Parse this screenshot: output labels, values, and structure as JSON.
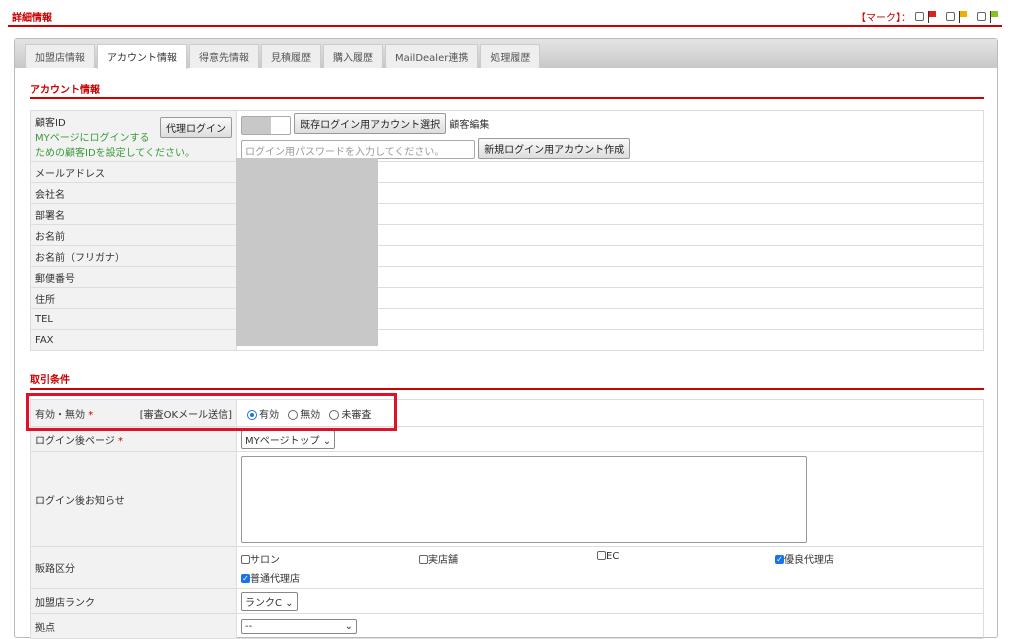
{
  "header": {
    "title": "詳細情報",
    "marks_label": "【マーク】：",
    "mark_colors": [
      "#e02020",
      "#f0b000",
      "#8ac020"
    ]
  },
  "tabs": [
    "加盟店情報",
    "アカウント情報",
    "得意先情報",
    "見積履歴",
    "購入履歴",
    "MailDealer連携",
    "処理履歴"
  ],
  "active_tab": 1,
  "account": {
    "section": "アカウント情報",
    "customer_id_label": "顧客ID",
    "customer_id_note1": "MYページにログインする",
    "customer_id_note2": "ための顧客IDを設定してください。",
    "proxy_login": "代理ログイン",
    "select_existing": "既存ログイン用アカウント選択",
    "edit_customer": "顧客編集",
    "password_placeholder": "ログイン用パスワードを入力してください。",
    "create_new": "新規ログイン用アカウント作成",
    "rows": [
      "メールアドレス",
      "会社名",
      "部署名",
      "お名前",
      "お名前（フリガナ）",
      "郵便番号",
      "住所",
      "TEL",
      "FAX"
    ]
  },
  "terms": {
    "section": "取引条件",
    "valid_label": "有効・無効",
    "mail_label": "[審査OKメール送信]",
    "radios": [
      "有効",
      "無効",
      "未審査"
    ],
    "login_page_label": "ログイン後ページ",
    "login_page_value": "MYページトップ",
    "notice_label": "ログイン後お知らせ",
    "channel_label": "販路区分",
    "channels": [
      {
        "label": "サロン",
        "checked": false
      },
      {
        "label": "実店舗",
        "checked": false
      },
      {
        "label": "EC",
        "checked": false
      },
      {
        "label": "優良代理店",
        "checked": true
      },
      {
        "label": "普通代理店",
        "checked": true
      }
    ],
    "rank_label": "加盟店ランク",
    "rank_value": "ランクC",
    "base_label": "拠点",
    "base_value": "--",
    "required_mark": "*"
  }
}
